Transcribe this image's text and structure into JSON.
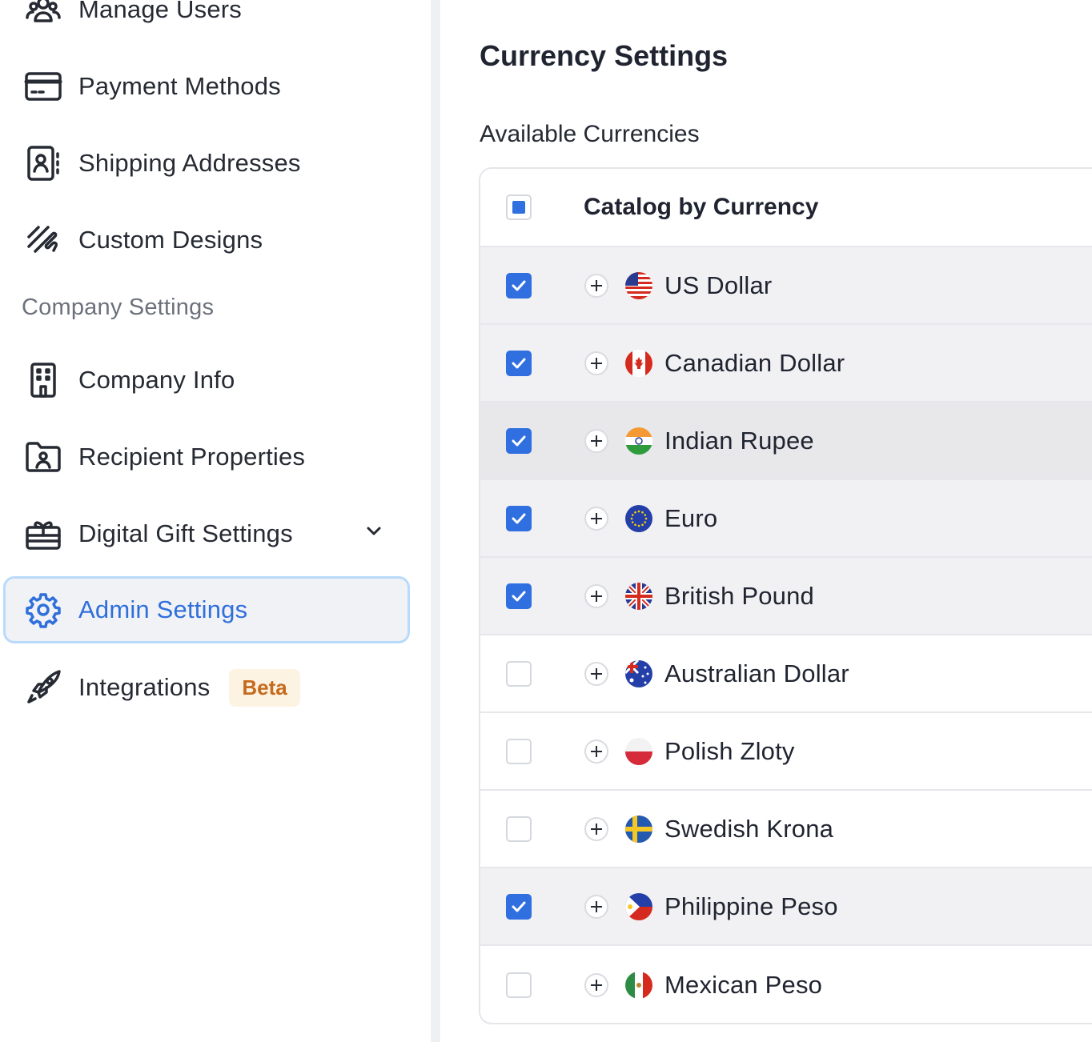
{
  "sidebar": {
    "items": [
      {
        "label": "Manage Users",
        "icon": "users-icon"
      },
      {
        "label": "Payment Methods",
        "icon": "credit-card-icon"
      },
      {
        "label": "Shipping Addresses",
        "icon": "address-book-icon"
      },
      {
        "label": "Custom Designs",
        "icon": "scribble-icon"
      }
    ],
    "section_heading": "Company Settings",
    "company_items": [
      {
        "label": "Company Info",
        "icon": "building-icon"
      },
      {
        "label": "Recipient Properties",
        "icon": "folder-user-icon"
      },
      {
        "label": "Digital Gift Settings",
        "icon": "gift-icon",
        "has_dropdown": true
      },
      {
        "label": "Admin Settings",
        "icon": "gear-icon",
        "active": true
      },
      {
        "label": "Integrations",
        "icon": "rocket-icon",
        "badge": "Beta"
      }
    ]
  },
  "main": {
    "title": "Currency Settings",
    "subheading": "Available Currencies",
    "table": {
      "column_title": "Catalog by Currency",
      "header_checkbox_state": "partial",
      "rows": [
        {
          "name": "US Dollar",
          "checked": true,
          "flag": "us-flag-icon"
        },
        {
          "name": "Canadian Dollar",
          "checked": true,
          "flag": "canada-flag-icon"
        },
        {
          "name": "Indian Rupee",
          "checked": true,
          "flag": "india-flag-icon"
        },
        {
          "name": "Euro",
          "checked": true,
          "flag": "eu-flag-icon"
        },
        {
          "name": "British Pound",
          "checked": true,
          "flag": "uk-flag-icon"
        },
        {
          "name": "Australian Dollar",
          "checked": false,
          "flag": "australia-flag-icon"
        },
        {
          "name": "Polish Zloty",
          "checked": false,
          "flag": "poland-flag-icon"
        },
        {
          "name": "Swedish Krona",
          "checked": false,
          "flag": "sweden-flag-icon"
        },
        {
          "name": "Philippine Peso",
          "checked": true,
          "flag": "philippines-flag-icon"
        },
        {
          "name": "Mexican Peso",
          "checked": false,
          "flag": "mexico-flag-icon"
        }
      ]
    }
  },
  "colors": {
    "accent": "#2f6fe0",
    "active_border": "#b9dafb",
    "badge_bg": "#fdf3e3",
    "badge_text": "#c66a1c"
  }
}
